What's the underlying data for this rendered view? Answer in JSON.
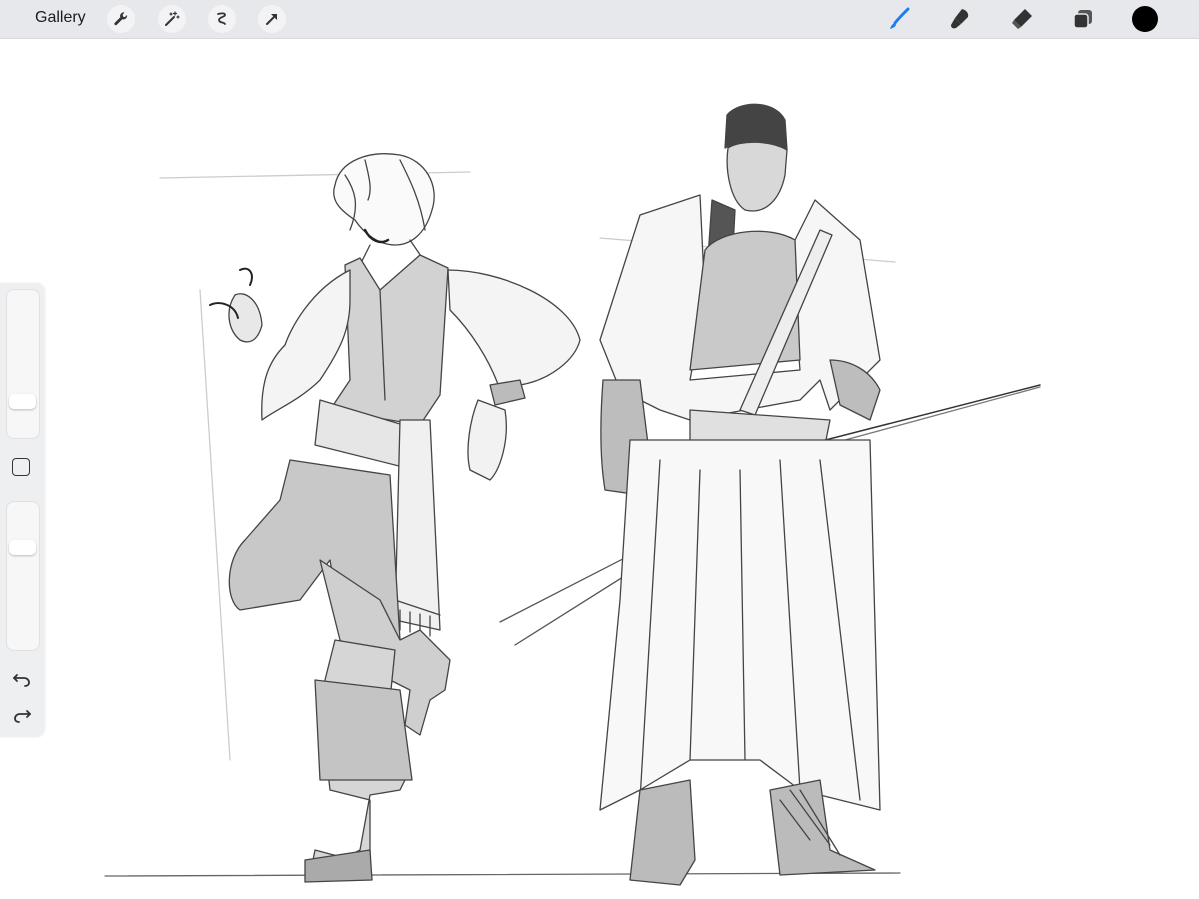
{
  "topbar": {
    "gallery_label": "Gallery",
    "left_tools": [
      "wrench-icon",
      "magic-wand-icon",
      "selection-icon",
      "transform-arrow-icon"
    ],
    "right_tools": [
      "brush-icon",
      "smudge-icon",
      "eraser-icon",
      "layers-icon"
    ],
    "active_tool": "brush",
    "current_color": "#000000",
    "accent_color": "#1e7cf2"
  },
  "sidebar": {
    "brush_size": 0.23,
    "brush_opacity": 0.8,
    "icons": [
      "modify-square-icon",
      "undo-icon",
      "redo-icon"
    ]
  },
  "canvas": {
    "content": "sketch-artwork"
  }
}
